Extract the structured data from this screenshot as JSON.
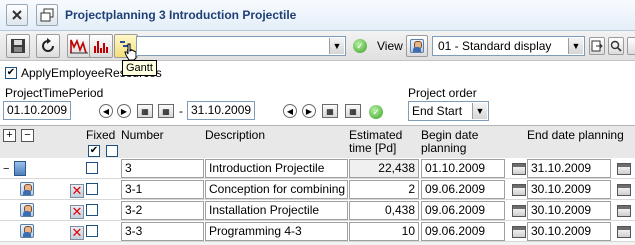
{
  "window": {
    "title": "Projectplanning 3 Introduction Projectile"
  },
  "toolbar": {
    "view_label": "View",
    "view_value": "01 - Standard display",
    "tooltip": "Gantt"
  },
  "filter": {
    "apply_checkbox_label": "ApplyEmployeeResources",
    "period_label": "ProjectTimePeriod",
    "date_from": "01.10.2009",
    "date_separator": "-",
    "date_to": "31.10.2009",
    "order_label": "Project order",
    "order_value": "End Start"
  },
  "grid": {
    "columns": {
      "fixed": "Fixed",
      "number": "Number",
      "description": "Description",
      "estimated_1": "Estimated",
      "estimated_2": "time [Pd]",
      "begin_1": "Begin date",
      "begin_2": "planning",
      "end": "End date planning"
    },
    "rows": [
      {
        "number": "3",
        "description": "Introduction Projectile",
        "estimated": "22,438",
        "begin": "01.10.2009",
        "end": "31.10.2009"
      },
      {
        "number": "3-1",
        "description": "Conception for combining",
        "estimated": "2",
        "begin": "09.06.2009",
        "end": "30.10.2009"
      },
      {
        "number": "3-2",
        "description": "Installation  Projectile",
        "estimated": "0,438",
        "begin": "09.06.2009",
        "end": "30.10.2009"
      },
      {
        "number": "3-3",
        "description": "Programming 4-3",
        "estimated": "10",
        "begin": "09.06.2009",
        "end": "30.10.2009"
      }
    ]
  },
  "colors": {
    "title": "#1f3f76",
    "error_icon": "#e00000",
    "ok_icon": "#37a01f"
  }
}
